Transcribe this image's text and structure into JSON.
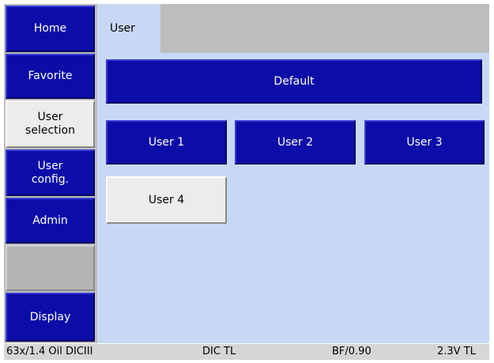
{
  "sidebar": {
    "items": [
      {
        "label": "Home"
      },
      {
        "label": "Favorite"
      },
      {
        "label": "User selection"
      },
      {
        "label": "User config."
      },
      {
        "label": "Admin"
      },
      {
        "label": ""
      },
      {
        "label": "Display"
      }
    ]
  },
  "tabs": [
    {
      "label": "User"
    }
  ],
  "main": {
    "default_label": "Default",
    "users": [
      {
        "label": "User 1"
      },
      {
        "label": "User 2"
      },
      {
        "label": "User 3"
      },
      {
        "label": "User 4"
      }
    ]
  },
  "status_bar": {
    "objective": "63x/1.4 Oil DICIII",
    "contrast": "DIC TL",
    "bf": "BF/0.90",
    "voltage": "2.3V TL"
  },
  "colors": {
    "button_blue": "#0c0ca8",
    "selected": "#ececec",
    "content_bg": "#c8d8f4",
    "panel_gray": "#bdbdbd"
  }
}
